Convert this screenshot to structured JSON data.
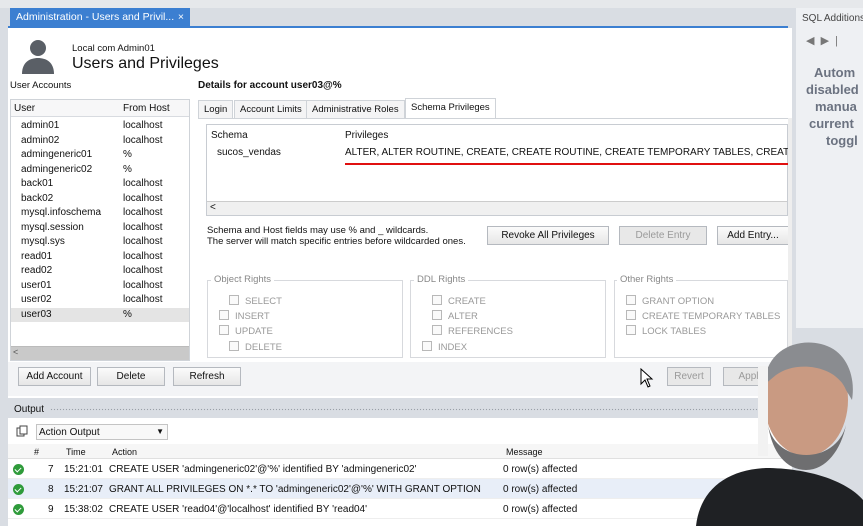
{
  "window": {
    "tab_title": "Administration - Users and Privil...",
    "tab_close": "×",
    "connection": "Local com Admin01",
    "page_title": "Users and Privileges"
  },
  "accounts": {
    "label": "User Accounts",
    "col_user": "User",
    "col_host": "From Host",
    "rows": [
      {
        "user": "admin01",
        "host": "localhost"
      },
      {
        "user": "admin02",
        "host": "localhost"
      },
      {
        "user": "admingeneric01",
        "host": "%"
      },
      {
        "user": "admingeneric02",
        "host": "%"
      },
      {
        "user": "back01",
        "host": "localhost"
      },
      {
        "user": "back02",
        "host": "localhost"
      },
      {
        "user": "mysql.infoschema",
        "host": "localhost"
      },
      {
        "user": "mysql.session",
        "host": "localhost"
      },
      {
        "user": "mysql.sys",
        "host": "localhost"
      },
      {
        "user": "read01",
        "host": "localhost"
      },
      {
        "user": "read02",
        "host": "localhost"
      },
      {
        "user": "user01",
        "host": "localhost"
      },
      {
        "user": "user02",
        "host": "localhost"
      },
      {
        "user": "user03",
        "host": "%"
      }
    ],
    "selected_user": "user03"
  },
  "details": {
    "heading": "Details for account user03@%",
    "tabs": [
      "Login",
      "Account Limits",
      "Administrative Roles",
      "Schema Privileges"
    ],
    "active_tab": "Schema Privileges",
    "schema_col": "Schema",
    "priv_col": "Privileges",
    "schema_value": "sucos_vendas",
    "priv_value": "ALTER, ALTER ROUTINE, CREATE, CREATE ROUTINE, CREATE TEMPORARY TABLES, CREATE VIE",
    "wildcard_line1": "Schema and Host fields may use % and _ wildcards.",
    "wildcard_line2": "The server will match specific entries before wildcarded ones.",
    "btn_revoke": "Revoke All Privileges",
    "btn_delete_entry": "Delete Entry",
    "btn_add_entry": "Add Entry...",
    "groups": {
      "object": {
        "title": "Object Rights",
        "items": [
          "SELECT",
          "INSERT",
          "UPDATE",
          "DELETE"
        ]
      },
      "ddl": {
        "title": "DDL Rights",
        "items": [
          "CREATE",
          "ALTER",
          "REFERENCES",
          "INDEX"
        ]
      },
      "other": {
        "title": "Other Rights",
        "items": [
          "GRANT OPTION",
          "CREATE TEMPORARY TABLES",
          "LOCK TABLES"
        ]
      }
    }
  },
  "actions": {
    "add_account": "Add Account",
    "delete": "Delete",
    "refresh": "Refresh",
    "revert": "Revert",
    "apply": "Apply"
  },
  "output": {
    "label": "Output",
    "selector": "Action Output",
    "cols": {
      "num": "#",
      "time": "Time",
      "action": "Action",
      "message": "Message"
    },
    "rows": [
      {
        "num": "7",
        "time": "15:21:01",
        "action": "CREATE USER 'admingeneric02'@'%' identified BY 'admingeneric02'",
        "message": "0 row(s) affected"
      },
      {
        "num": "8",
        "time": "15:21:07",
        "action": "GRANT ALL PRIVILEGES ON *.* TO 'admingeneric02'@'%' WITH GRANT OPTION",
        "message": "0 row(s) affected"
      },
      {
        "num": "9",
        "time": "15:38:02",
        "action": "CREATE USER 'read04'@'localhost' identified BY 'read04'",
        "message": "0 row(s) affected"
      }
    ]
  },
  "right_panel": {
    "title": "SQL Additions",
    "lines": [
      "Autom",
      "disabled",
      "manua",
      "current",
      "toggl"
    ]
  },
  "colors": {
    "accent": "#3c7fd1",
    "underline": "#e01010",
    "ok": "#2f9b3b"
  }
}
